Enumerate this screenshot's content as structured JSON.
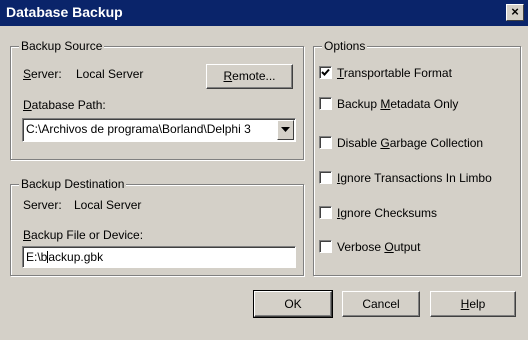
{
  "window": {
    "title": "Database Backup",
    "close_glyph": "×"
  },
  "backup_source": {
    "group_title": "Backup Source",
    "server_prefix": "S",
    "server_rest": "erver:",
    "server_value": "Local Server",
    "remote_prefix": "R",
    "remote_rest": "emote...",
    "db_path_prefix": "D",
    "db_path_rest": "atabase Path:",
    "db_path_value": "C:\\Archivos de programa\\Borland\\Delphi 3"
  },
  "backup_destination": {
    "group_title": "Backup Destination",
    "server_label": "Server:",
    "server_value": "Local Server",
    "file_prefix": "B",
    "file_rest": "ackup File or Device:",
    "file_value_before_caret": "E:\\b",
    "file_value_after_caret": "ackup.gbk"
  },
  "options": {
    "group_title": "Options",
    "items": [
      {
        "pre": "",
        "key": "T",
        "post": "ransportable Format",
        "checked": true
      },
      {
        "pre": "Backup ",
        "key": "M",
        "post": "etadata Only",
        "checked": false
      },
      {
        "pre": "Disable ",
        "key": "G",
        "post": "arbage Collection",
        "checked": false
      },
      {
        "pre": "",
        "key": "I",
        "post": "gnore Transactions In Limbo",
        "checked": false
      },
      {
        "pre": "",
        "key": "I",
        "post": "gnore Checksums",
        "checked": false
      },
      {
        "pre": "Verbose ",
        "key": "O",
        "post": "utput",
        "checked": false
      }
    ]
  },
  "buttons": {
    "ok": "OK",
    "cancel": "Cancel",
    "help_key": "H",
    "help_rest": "elp"
  },
  "icons": {
    "dropdown": "chevron-down-icon",
    "check": "check-icon"
  }
}
